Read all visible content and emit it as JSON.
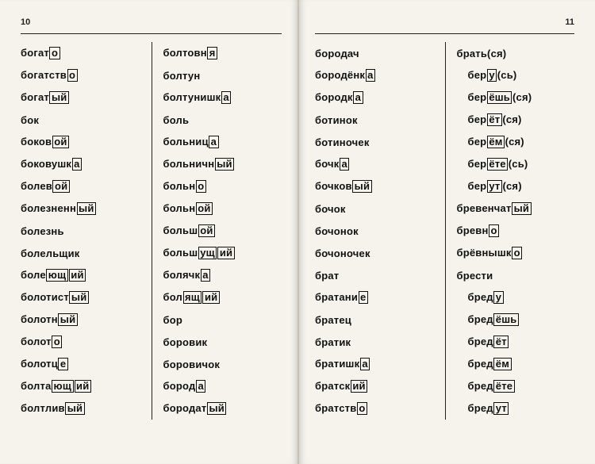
{
  "pages": {
    "left": {
      "number": "10"
    },
    "right": {
      "number": "11"
    }
  },
  "columns": {
    "c1": [
      {
        "pre": "богат",
        "box": "о",
        "post": ""
      },
      {
        "pre": "богатств",
        "box": "о",
        "post": ""
      },
      {
        "pre": "богат",
        "box": "ый",
        "post": ""
      },
      {
        "pre": "бок",
        "box": "",
        "post": ""
      },
      {
        "pre": "боков",
        "box": "ой",
        "post": ""
      },
      {
        "pre": "боковушк",
        "box": "а",
        "post": ""
      },
      {
        "pre": "болев",
        "box": "ой",
        "post": ""
      },
      {
        "pre": "болезненн",
        "box": "ый",
        "post": ""
      },
      {
        "pre": "болезнь",
        "box": "",
        "post": ""
      },
      {
        "pre": "болельщик",
        "box": "",
        "post": ""
      },
      {
        "pre": "боле",
        "box": "ющ",
        "post": "",
        "box2": "ий"
      },
      {
        "pre": "болотист",
        "box": "ый",
        "post": ""
      },
      {
        "pre": "болотн",
        "box": "ый",
        "post": ""
      },
      {
        "pre": "болот",
        "box": "о",
        "post": ""
      },
      {
        "pre": "болотц",
        "box": "е",
        "post": ""
      },
      {
        "pre": "болта",
        "box": "ющ",
        "post": "",
        "box2": "ий"
      },
      {
        "pre": "болтлив",
        "box": "ый",
        "post": ""
      }
    ],
    "c2": [
      {
        "pre": "болтовн",
        "box": "я",
        "post": ""
      },
      {
        "pre": "болтун",
        "box": "",
        "post": ""
      },
      {
        "pre": "болтунишк",
        "box": "а",
        "post": ""
      },
      {
        "pre": "боль",
        "box": "",
        "post": ""
      },
      {
        "pre": "больниц",
        "box": "а",
        "post": ""
      },
      {
        "pre": "больничн",
        "box": "ый",
        "post": ""
      },
      {
        "pre": "больн",
        "box": "о",
        "post": ""
      },
      {
        "pre": "больн",
        "box": "ой",
        "post": ""
      },
      {
        "pre": "больш",
        "box": "ой",
        "post": ""
      },
      {
        "pre": "больш",
        "box": "ущ",
        "post": "",
        "box2": "ий"
      },
      {
        "pre": "болячк",
        "box": "а",
        "post": ""
      },
      {
        "pre": "бол",
        "box": "ящ",
        "post": "",
        "box2": "ий"
      },
      {
        "pre": "бор",
        "box": "",
        "post": ""
      },
      {
        "pre": "боровик",
        "box": "",
        "post": ""
      },
      {
        "pre": "боровичок",
        "box": "",
        "post": ""
      },
      {
        "pre": "бород",
        "box": "а",
        "post": ""
      },
      {
        "pre": "бородат",
        "box": "ый",
        "post": ""
      }
    ],
    "c3": [
      {
        "pre": "бородач",
        "box": "",
        "post": ""
      },
      {
        "pre": "бородёнк",
        "box": "а",
        "post": ""
      },
      {
        "pre": "бородк",
        "box": "а",
        "post": ""
      },
      {
        "pre": "ботинок",
        "box": "",
        "post": ""
      },
      {
        "pre": "ботиночек",
        "box": "",
        "post": ""
      },
      {
        "pre": "бочк",
        "box": "а",
        "post": ""
      },
      {
        "pre": "бочков",
        "box": "ый",
        "post": ""
      },
      {
        "pre": "бочок",
        "box": "",
        "post": ""
      },
      {
        "pre": "бочонок",
        "box": "",
        "post": ""
      },
      {
        "pre": "бочоночек",
        "box": "",
        "post": ""
      },
      {
        "pre": "брат",
        "box": "",
        "post": ""
      },
      {
        "pre": "братани",
        "box": "е",
        "post": ""
      },
      {
        "pre": "братец",
        "box": "",
        "post": ""
      },
      {
        "pre": "братик",
        "box": "",
        "post": ""
      },
      {
        "pre": "братишк",
        "box": "а",
        "post": ""
      },
      {
        "pre": "братск",
        "box": "ий",
        "post": ""
      },
      {
        "pre": "братств",
        "box": "о",
        "post": ""
      }
    ],
    "c4": [
      {
        "pre": "брать(ся)",
        "box": "",
        "post": ""
      },
      {
        "pre": "бер",
        "box": "у",
        "post": "(сь)",
        "indent": true
      },
      {
        "pre": "бер",
        "box": "ёшь",
        "post": "(ся)",
        "indent": true
      },
      {
        "pre": "бер",
        "box": "ёт",
        "post": "(ся)",
        "indent": true
      },
      {
        "pre": "бер",
        "box": "ём",
        "post": "(ся)",
        "indent": true
      },
      {
        "pre": "бер",
        "box": "ёте",
        "post": "(сь)",
        "indent": true
      },
      {
        "pre": "бер",
        "box": "ут",
        "post": "(ся)",
        "indent": true
      },
      {
        "pre": "бревенчат",
        "box": "ый",
        "post": ""
      },
      {
        "pre": "бревн",
        "box": "о",
        "post": ""
      },
      {
        "pre": "брёвнышк",
        "box": "о",
        "post": ""
      },
      {
        "pre": "брести",
        "box": "",
        "post": ""
      },
      {
        "pre": "бред",
        "box": "у",
        "post": "",
        "indent": true
      },
      {
        "pre": "бред",
        "box": "ёшь",
        "post": "",
        "indent": true
      },
      {
        "pre": "бред",
        "box": "ёт",
        "post": "",
        "indent": true
      },
      {
        "pre": "бред",
        "box": "ём",
        "post": "",
        "indent": true
      },
      {
        "pre": "бред",
        "box": "ёте",
        "post": "",
        "indent": true
      },
      {
        "pre": "бред",
        "box": "ут",
        "post": "",
        "indent": true
      }
    ]
  }
}
